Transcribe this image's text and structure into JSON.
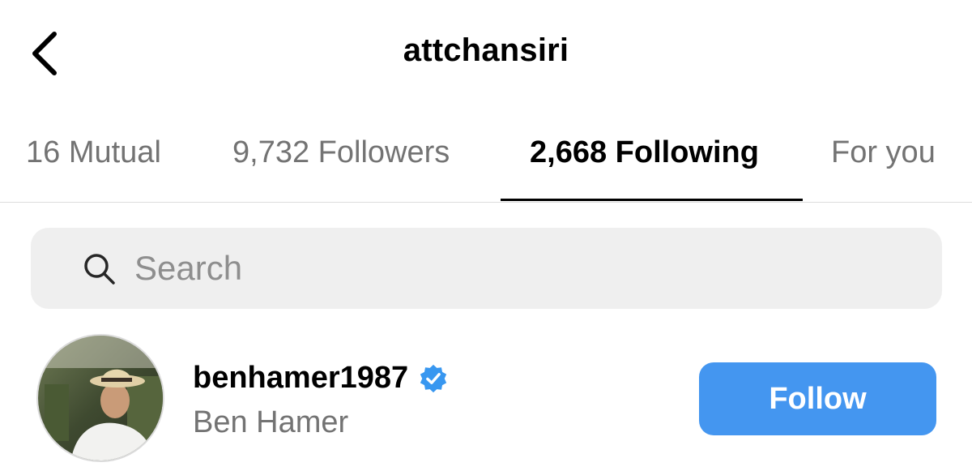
{
  "header": {
    "title": "attchansiri",
    "back_icon": "chevron-left-icon"
  },
  "tabs": [
    {
      "label": "16 Mutual",
      "active": false
    },
    {
      "label": "9,732 Followers",
      "active": false
    },
    {
      "label": "2,668 Following",
      "active": true
    },
    {
      "label": "For you",
      "active": false
    }
  ],
  "search": {
    "placeholder": "Search",
    "value": "",
    "icon": "search-icon"
  },
  "users": [
    {
      "username": "benhamer1987",
      "full_name": "Ben Hamer",
      "verified": true,
      "verified_icon": "verified-badge-icon",
      "follow_label": "Follow"
    }
  ],
  "colors": {
    "follow_button": "#4496f0",
    "verified_badge": "#3897f0",
    "muted_text": "#737373",
    "search_bg": "#efefef"
  }
}
